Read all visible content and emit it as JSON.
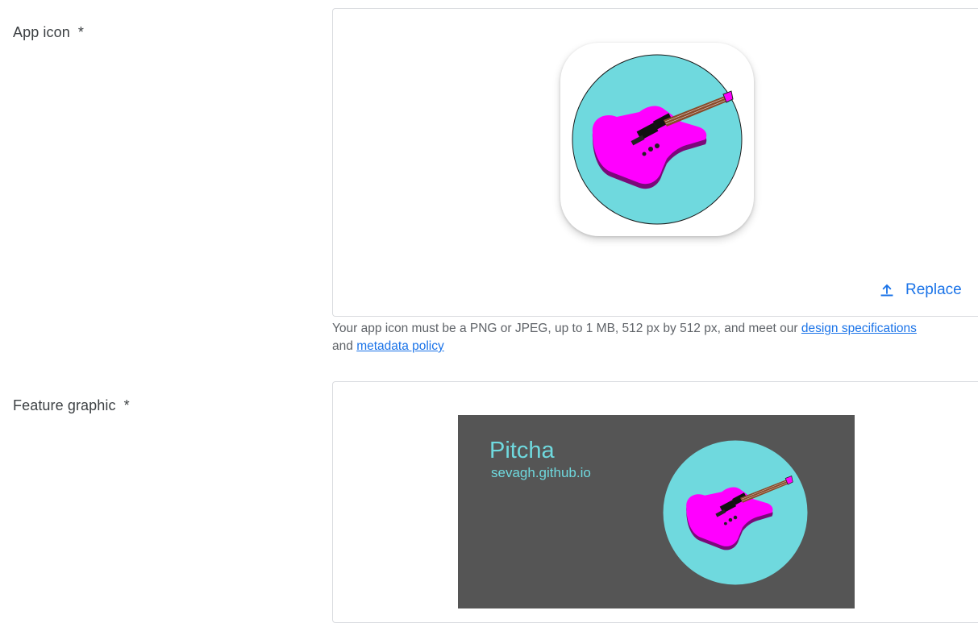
{
  "app_icon": {
    "label": "App icon",
    "required_mark": "*",
    "replace_label": "Replace",
    "help_prefix": "Your app icon must be a PNG or JPEG, up to 1 MB, 512 px by 512 px, and meet our ",
    "design_link": "design specifications",
    "help_and": "and",
    "metadata_link": "metadata policy"
  },
  "feature_graphic": {
    "label": "Feature graphic",
    "required_mark": "*",
    "title": "Pitcha",
    "subtitle": "sevagh.github.io"
  },
  "colors": {
    "link": "#1a73e8",
    "icon_circle": "#6fd9de",
    "guitar_body": "#ff00ff",
    "feature_bg": "#555555"
  }
}
